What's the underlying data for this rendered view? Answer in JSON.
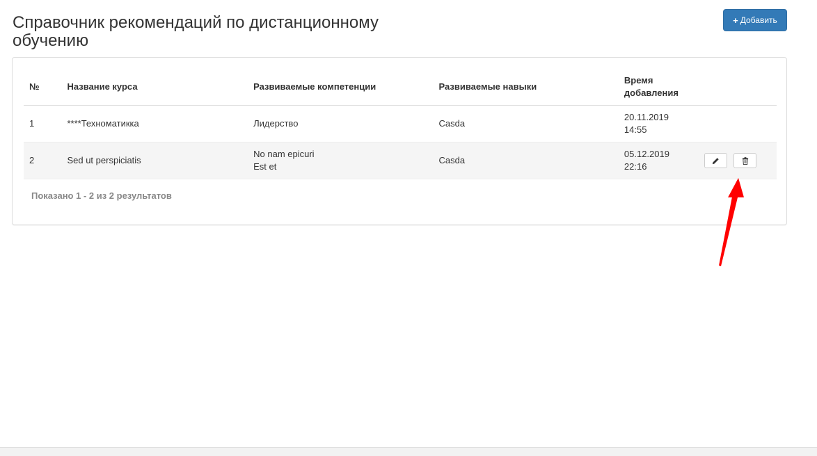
{
  "header": {
    "title": "Справочник рекомендаций по дистанционному обучению",
    "add_button_label": "Добавить",
    "add_icon": "plus-icon"
  },
  "table": {
    "columns": [
      "№",
      "Название курса",
      "Развиваемые компетенции",
      "Развиваемые навыки",
      "Время добавления"
    ],
    "rows": [
      {
        "num": "1",
        "course": "****Техноматикка",
        "competencies": [
          "Лидерство"
        ],
        "skills": "Casda",
        "date": "20.11.2019",
        "time": "14:55"
      },
      {
        "num": "2",
        "course": "Sed ut perspiciatis",
        "competencies": [
          "No nam epicuri",
          "Est et"
        ],
        "skills": "Casda",
        "date": "05.12.2019",
        "time": "22:16",
        "actions": [
          {
            "name": "edit",
            "icon": "pencil-icon"
          },
          {
            "name": "delete",
            "icon": "trash-icon"
          }
        ]
      }
    ]
  },
  "summary": "Показано 1 - 2 из 2 результатов",
  "colors": {
    "primary": "#337ab7",
    "arrow": "#ff0000",
    "striped_row": "#f5f5f5"
  }
}
